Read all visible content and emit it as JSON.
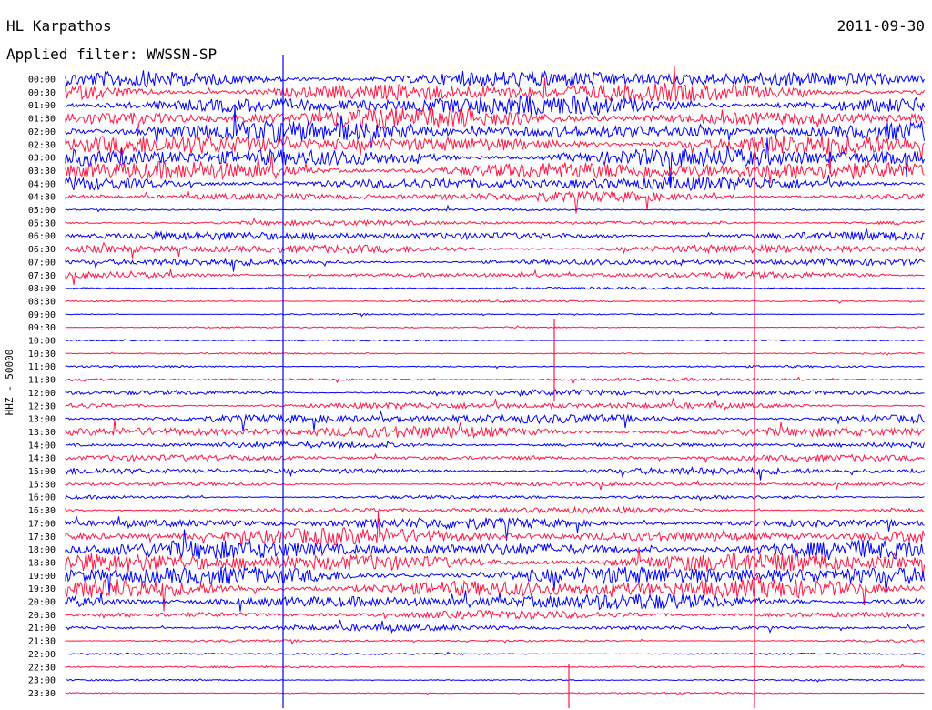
{
  "header": {
    "station": "HL Karpathos",
    "date": "2011-09-30",
    "filter": "Applied filter: WWSSN-SP"
  },
  "chart_data": {
    "type": "line",
    "channel_label": "HHZ - 50000",
    "colors": {
      "even_rows": "#0000ff",
      "odd_rows": "#ff1744"
    },
    "grid": false,
    "legend": "none",
    "rows": [
      {
        "label": "00:00",
        "amp": 0.9
      },
      {
        "label": "00:30",
        "amp": 1.0
      },
      {
        "label": "01:00",
        "amp": 1.0
      },
      {
        "label": "01:30",
        "amp": 1.0
      },
      {
        "label": "02:00",
        "amp": 1.0
      },
      {
        "label": "02:30",
        "amp": 1.0
      },
      {
        "label": "03:00",
        "amp": 1.0
      },
      {
        "label": "03:30",
        "amp": 1.0
      },
      {
        "label": "04:00",
        "amp": 0.7
      },
      {
        "label": "04:30",
        "amp": 0.5
      },
      {
        "label": "05:00",
        "amp": 0.12
      },
      {
        "label": "05:30",
        "amp": 0.25
      },
      {
        "label": "06:00",
        "amp": 0.45
      },
      {
        "label": "06:30",
        "amp": 0.45
      },
      {
        "label": "07:00",
        "amp": 0.35
      },
      {
        "label": "07:30",
        "amp": 0.3
      },
      {
        "label": "08:00",
        "amp": 0.12
      },
      {
        "label": "08:30",
        "amp": 0.1
      },
      {
        "label": "09:00",
        "amp": 0.08
      },
      {
        "label": "09:30",
        "amp": 0.08
      },
      {
        "label": "10:00",
        "amp": 0.08
      },
      {
        "label": "10:30",
        "amp": 0.08
      },
      {
        "label": "11:00",
        "amp": 0.1
      },
      {
        "label": "11:30",
        "amp": 0.15
      },
      {
        "label": "12:00",
        "amp": 0.3
      },
      {
        "label": "12:30",
        "amp": 0.35
      },
      {
        "label": "13:00",
        "amp": 0.5
      },
      {
        "label": "13:30",
        "amp": 0.6
      },
      {
        "label": "14:00",
        "amp": 0.3
      },
      {
        "label": "14:30",
        "amp": 0.3
      },
      {
        "label": "15:00",
        "amp": 0.35
      },
      {
        "label": "15:30",
        "amp": 0.2
      },
      {
        "label": "16:00",
        "amp": 0.2
      },
      {
        "label": "16:30",
        "amp": 0.3
      },
      {
        "label": "17:00",
        "amp": 0.55
      },
      {
        "label": "17:30",
        "amp": 0.8
      },
      {
        "label": "18:00",
        "amp": 0.9
      },
      {
        "label": "18:30",
        "amp": 1.0
      },
      {
        "label": "19:00",
        "amp": 1.0
      },
      {
        "label": "19:30",
        "amp": 1.0
      },
      {
        "label": "20:00",
        "amp": 0.8
      },
      {
        "label": "20:30",
        "amp": 0.4
      },
      {
        "label": "21:00",
        "amp": 0.3
      },
      {
        "label": "21:30",
        "amp": 0.12
      },
      {
        "label": "22:00",
        "amp": 0.1
      },
      {
        "label": "22:30",
        "amp": 0.1
      },
      {
        "label": "23:00",
        "amp": 0.08
      },
      {
        "label": "23:30",
        "amp": 0.08
      }
    ]
  }
}
